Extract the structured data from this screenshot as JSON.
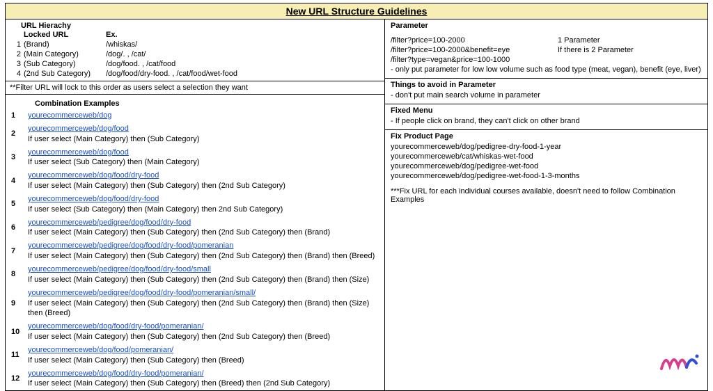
{
  "title": "New URL Structure Guidelines",
  "hierarchy": {
    "heading": "URL Hierachy",
    "col_locked": "Locked URL",
    "col_ex": "Ex.",
    "rows": [
      {
        "n": "1",
        "label": "(Brand)",
        "ex": "/whiskas/"
      },
      {
        "n": "2",
        "label": "(Main Category)",
        "ex": "/dog/.   ,   /cat/"
      },
      {
        "n": "3",
        "label": "(Sub Category)",
        "ex": "/dog/food.   ,   /cat/food"
      },
      {
        "n": "4",
        "label": "(2nd Sub Category)",
        "ex": "/dog/food/dry-food.  , /cat/food/wet-food"
      }
    ],
    "note": "**Filter URL will lock to this order as users select a selection they want"
  },
  "combos": {
    "heading": "Combination Examples",
    "items": [
      {
        "n": "1",
        "url": "yourecommerceweb/dog",
        "desc": ""
      },
      {
        "n": "2",
        "url": "yourecommerceweb/dog/food",
        "desc": "If user select (Main Category) then (Sub Category)"
      },
      {
        "n": "3",
        "url": "yourecommerceweb/dog/food",
        "desc": "If user select  (Sub Category) then (Main Category)"
      },
      {
        "n": "4",
        "url": "yourecommerceweb/dog/food/dry-food",
        "desc": "If user select (Main Category) then (Sub Category) then (2nd Sub Category)"
      },
      {
        "n": "5",
        "url": "yourecommerceweb/dog/food/dry-food",
        "desc": "If user select  (Sub Category) then (Main Category) then 2nd Sub Category)"
      },
      {
        "n": "6",
        "url": "yourecommerceweb/pedigree/dog/food/dry-food",
        "desc": "If user select (Main Category) then (Sub Category) then (2nd Sub Category) then (Brand)"
      },
      {
        "n": "7",
        "url": "yourecommerceweb/pedigree/dog/food/dry-food/pomeranian",
        "desc": "If user select (Main Category) then (Sub Category) then (2nd Sub Category) then (Brand) then (Breed)"
      },
      {
        "n": "8",
        "url": "yourecommerceweb/pedigree/dog/food/dry-food/small",
        "desc": "If user select (Main Category) then (Sub Category) then (2nd Sub Category) then (Brand) then (Size)"
      },
      {
        "n": "9",
        "url": "yourecommerceweb/pedigree/dog/food/dry-food/pomeranian/small/",
        "desc": "If user select (Main Category) then (Sub Category) then (2nd Sub Category) then (Brand) then (Size) then (Breed)"
      },
      {
        "n": "10",
        "url": "yourecommerceweb/dog/food/dry-food/pomeranian/",
        "desc": "If user select (Main Category) then (Sub Category) then (2nd Sub Category) then (Breed)"
      },
      {
        "n": "11",
        "url": "yourecommerceweb/dog/food/pomeranian/",
        "desc": "If user select (Main Category) then (Sub Category) then (Breed)"
      },
      {
        "n": "12",
        "url": "yourecommerceweb/dog/food/dry-food/pomeranian/",
        "desc": "If user select (Main Category) then (Sub Category) then (Breed) then (2nd Sub Category)"
      }
    ]
  },
  "parameter": {
    "heading": "Parameter",
    "rows": [
      {
        "a": "/filter?price=100-2000",
        "b": "1 Parameter"
      },
      {
        "a": "/filter?price=100-2000&benefit=eye",
        "b": "If there is 2 Parameter"
      },
      {
        "a": "/filter?type=vegan&price=100-1000",
        "b": ""
      }
    ],
    "note": "- only put parameter for low low volume such as food type (meat, vegan), benefit (eye, liver)"
  },
  "avoid": {
    "heading": "Things to avoid in Parameter",
    "line": "- don't put main search volume in parameter"
  },
  "fixed_menu": {
    "heading": "Fixed Menu",
    "line": "- If people click on brand, they can't click on other brand"
  },
  "fix_product": {
    "heading": "Fix Product Page",
    "lines": [
      "yourecommerceweb/dog/pedigree-dry-food-1-year",
      "yourecommerceweb/cat/whiskas-wet-food",
      "yourecommerceweb/dog/pedigree-wet-food",
      "yourecommerceweb/dog/pedigree-wet-food-1-3-months"
    ],
    "note": "***Fix URL for each individual courses available, doesn't need to follow Combination Examples"
  }
}
